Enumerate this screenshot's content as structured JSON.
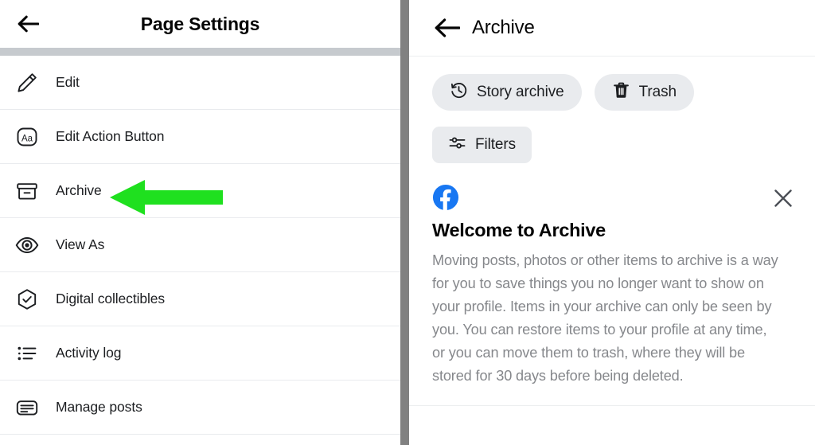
{
  "left_panel": {
    "back_icon": "arrow-left-icon",
    "title": "Page Settings",
    "items": [
      {
        "icon": "pencil-icon",
        "label": "Edit"
      },
      {
        "icon": "text-box-icon",
        "label": "Edit Action Button"
      },
      {
        "icon": "archive-box-icon",
        "label": "Archive"
      },
      {
        "icon": "eye-icon",
        "label": "View As"
      },
      {
        "icon": "hexagon-check-icon",
        "label": "Digital collectibles"
      },
      {
        "icon": "bullet-list-icon",
        "label": "Activity log"
      },
      {
        "icon": "post-lines-icon",
        "label": "Manage posts"
      }
    ]
  },
  "annotation": {
    "type": "arrow-left-annotation",
    "color": "#1fe01f",
    "points_to": "Archive"
  },
  "right_panel": {
    "back_icon": "arrow-left-icon",
    "title": "Archive",
    "chips": [
      {
        "icon": "history-clock-icon",
        "label": "Story archive"
      },
      {
        "icon": "trash-icon",
        "label": "Trash"
      }
    ],
    "filters": {
      "icon": "sliders-icon",
      "label": "Filters"
    },
    "notice": {
      "brand_icon": "facebook-logo-icon",
      "brand_color": "#1877f2",
      "title": "Welcome to Archive",
      "body": "Moving posts, photos or other items to archive is a way for you to save things you no longer want to show on your profile. Items in your archive can only be seen by you. You can restore items to your profile at any time, or you can move them to trash, where they will be stored for 30 days before being deleted.",
      "close_icon": "close-icon"
    }
  }
}
